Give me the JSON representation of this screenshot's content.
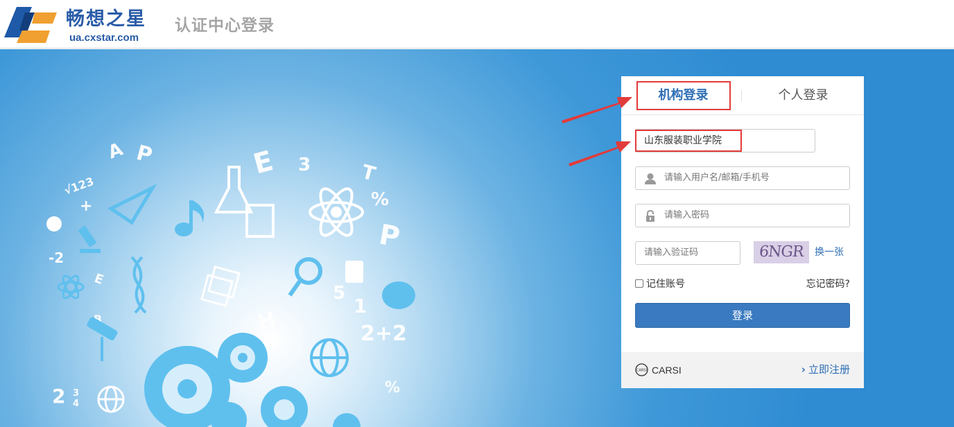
{
  "header": {
    "brand_name": "畅想之星",
    "brand_url": "ua.cxstar.com",
    "page_title": "认证中心登录"
  },
  "login": {
    "tabs": [
      {
        "label": "机构登录",
        "active": true
      },
      {
        "label": "个人登录",
        "active": false
      }
    ],
    "institution_value": "山东服装职业学院",
    "username_placeholder": "请输入用户名/邮箱/手机号",
    "password_placeholder": "请输入密码",
    "captcha_placeholder": "请输入验证码",
    "captcha_text": "6NGR",
    "refresh_label": "换一张",
    "remember_label": "记住账号",
    "forgot_label": "忘记密码?",
    "submit_label": "登录",
    "carsi_label": "CARSI",
    "register_label": "立即注册"
  },
  "colors": {
    "accent": "#2f6fb5",
    "button": "#3a7ac0",
    "annotation": "#e23b3b",
    "brand": "#2a5ca8"
  },
  "icons": [
    "logo-icon",
    "user-icon",
    "lock-icon",
    "carsi-icon",
    "chevron-right-icon",
    "arrow-annotation"
  ]
}
